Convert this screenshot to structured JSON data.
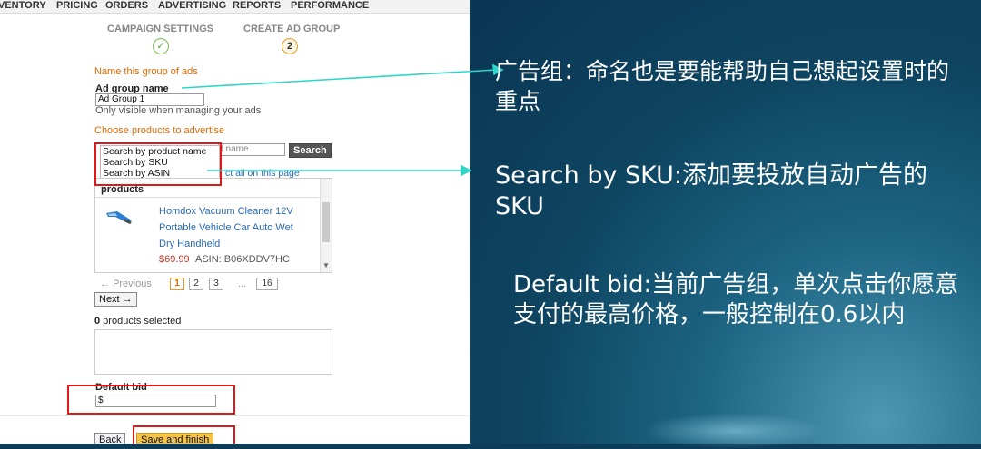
{
  "nav": {
    "items": [
      "VENTORY",
      "PRICING",
      "ORDERS",
      "ADVERTISING",
      "REPORTS",
      "PERFORMANCE"
    ]
  },
  "steps": {
    "step1_label": "CAMPAIGN SETTINGS",
    "step1_mark": "✓",
    "step2_label": "CREATE AD GROUP",
    "step2_mark": "2"
  },
  "form": {
    "name_heading": "Name this group of ads",
    "ad_group_label": "Ad group name",
    "ad_group_value": "Ad Group 1",
    "ad_group_hint": "Only visible when managing your ads",
    "choose_heading": "Choose products to advertise",
    "search_placeholder": "t name",
    "search_button": "Search",
    "dropdown_options": [
      "Search by product name",
      "Search by SKU",
      "Search by ASIN"
    ],
    "select_all_fragment": "ct all on this page",
    "products_header": "products",
    "product": {
      "title_line1": "Homdox Vacuum Cleaner 12V",
      "title_line2": "Portable Vehicle Car Auto Wet",
      "title_line3": "Dry Handheld",
      "price": "$69.99",
      "asin": "ASIN: B06XDDV7HC"
    },
    "pager": {
      "previous": "← Previous",
      "pages": [
        "1",
        "2",
        "3"
      ],
      "ellipsis": "...",
      "last": "16",
      "next": "Next →"
    },
    "selected_count": "0",
    "selected_suffix": " products selected",
    "default_bid_label": "Default bid",
    "default_bid_value": "$",
    "back_button": "Back",
    "save_button": "Save and finish"
  },
  "notes": {
    "note1": "广告组：命名也是要能帮助自己想起设置时的重点",
    "note2": "Search by SKU:添加要投放自动广告的SKU",
    "note3": "Default bid:当前广告组，单次点击你愿意支付的最高价格，一般控制在0.6以内"
  },
  "colors": {
    "annotation_red": "#e01818",
    "arrow_teal": "#2fd6c8",
    "accent_orange": "#e06a00",
    "slide_bg": "#0e4561"
  }
}
